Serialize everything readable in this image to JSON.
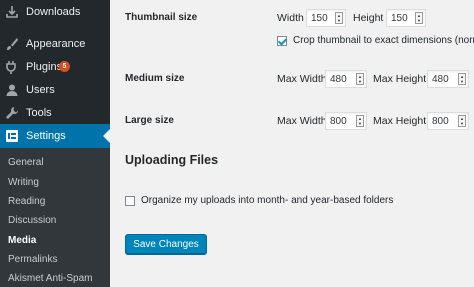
{
  "sidebar": {
    "items": [
      {
        "label": "Downloads",
        "icon": "download-icon"
      },
      {
        "label": "Appearance",
        "icon": "paintbrush-icon"
      },
      {
        "label": "Plugins",
        "icon": "plugin-icon",
        "badge": "5"
      },
      {
        "label": "Users",
        "icon": "user-icon"
      },
      {
        "label": "Tools",
        "icon": "wrench-icon"
      },
      {
        "label": "Settings",
        "icon": "settings-icon",
        "active": true
      }
    ],
    "submenu": [
      "General",
      "Writing",
      "Reading",
      "Discussion",
      "Media",
      "Permalinks",
      "Akismet Anti-Spam"
    ],
    "current_submenu": "Media"
  },
  "settings": {
    "thumbnail": {
      "label": "Thumbnail size",
      "width_label": "Width",
      "width": "150",
      "height_label": "Height",
      "height": "150",
      "crop_label": "Crop thumbnail to exact dimensions (norma",
      "crop_checked": true
    },
    "medium": {
      "label": "Medium size",
      "max_width_label": "Max Width",
      "max_width": "480",
      "max_height_label": "Max Height",
      "max_height": "480"
    },
    "large": {
      "label": "Large size",
      "max_width_label": "Max Width",
      "max_width": "800",
      "max_height_label": "Max Height",
      "max_height": "800"
    },
    "uploading": {
      "title": "Uploading Files",
      "organize_label": "Organize my uploads into month- and year-based folders",
      "organize_checked": false
    },
    "save_label": "Save Changes"
  },
  "colors": {
    "sidebar_bg": "#23282d",
    "submenu_bg": "#32373c",
    "active_bg": "#0073aa",
    "button_bg": "#0085ba",
    "badge_bg": "#d54e21"
  }
}
